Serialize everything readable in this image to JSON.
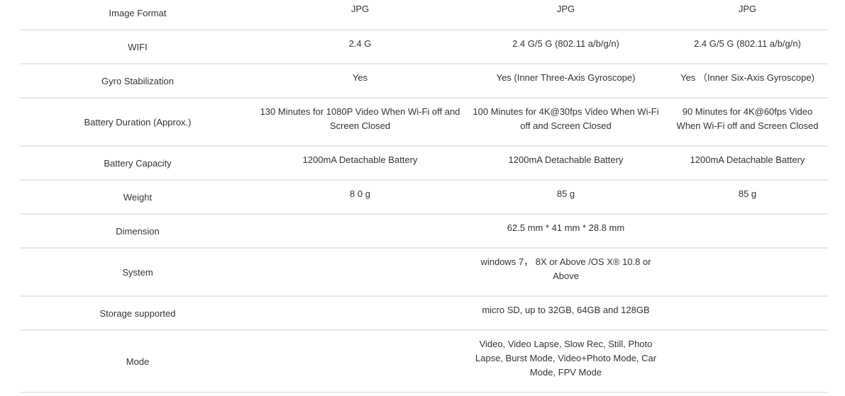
{
  "specs": {
    "rows": [
      {
        "label": "Image Format",
        "values": [
          "JPG",
          "JPG",
          "JPG"
        ]
      },
      {
        "label": "WIFI",
        "values": [
          "2.4 G",
          "2.4 G/5 G (802.11 a/b/g/n)",
          "2.4 G/5 G (802.11 a/b/g/n)"
        ]
      },
      {
        "label": "Gyro Stabilization",
        "values": [
          "Yes",
          "Yes (Inner Three-Axis Gyroscope)",
          "Yes （Inner Six-Axis Gyroscope)"
        ]
      },
      {
        "label": "Battery Duration (Approx.)",
        "values": [
          "130 Minutes for 1080P Video When Wi-Fi off and Screen Closed",
          "100 Minutes for 4K@30fps Video When Wi-Fi off and Screen Closed",
          "90 Minutes for 4K@60fps Video When Wi-Fi off and Screen Closed"
        ]
      },
      {
        "label": "Battery Capacity",
        "values": [
          "1200mA Detachable Battery",
          "1200mA Detachable Battery",
          "1200mA Detachable Battery"
        ]
      },
      {
        "label": "Weight",
        "values": [
          "8 0 g",
          "85 g",
          "85 g"
        ]
      },
      {
        "label": "Dimension",
        "values": [
          "",
          "62.5 mm * 41 mm * 28.8 mm",
          ""
        ]
      },
      {
        "label": "System",
        "values": [
          "",
          "windows 7， 8X or Above /OS X® 10.8 or Above",
          ""
        ]
      },
      {
        "label": "Storage supported",
        "values": [
          "",
          "micro SD, up to 32GB, 64GB and 128GB",
          ""
        ]
      },
      {
        "label": "Mode",
        "values": [
          "",
          "Video, Video Lapse, Slow Rec, Still, Photo Lapse, Burst Mode, Video+Photo Mode, Car Mode, FPV Mode",
          ""
        ]
      }
    ]
  }
}
